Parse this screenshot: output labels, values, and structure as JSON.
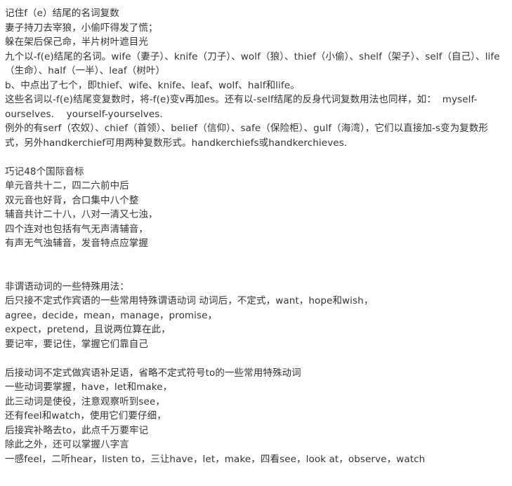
{
  "document": {
    "sections": [
      {
        "id": "f-e-plural-nouns",
        "lines": [
          "记住f（e）结尾的名词复数",
          "妻子持刀去宰狼，小偷吓得发了慌；",
          "躲在架后保己命，半片树叶遮目光",
          "九个以-f(e)结尾的名词。wife（妻子）、knife（刀子）、wolf（狼）、thief（小偷）、shelf（架子）、self（自己）、life（生命）、half（一半）、leaf（树叶）",
          "b、中点出了七个，即thief、wife、knife、leaf、wolf、half和life。",
          "这些名词以-f(e)结尾变复数时，将-f(e)变v再加es。还有以-self结尾的反身代词复数用法也同样，如：  myself-ourselves.    yourself-yourselves.",
          "例外的有serf（农奴）、chief（首领）、belief（信仰）、safe（保险柜）、gulf（海湾），它们以直接加-s变为复数形式，另外handkerchief可用两种复数形式。handkerchiefs或handkerchieves."
        ]
      },
      {
        "id": "phonetic-symbols",
        "lines": [
          "巧记48个国际音标",
          "单元音共十二，四二六前中后",
          "双元音也好背，合口集中八个整",
          "辅音共计二十八，八对一清又七浊，",
          "四个连对也包括有气无声清辅音，",
          "有声无气浊辅音，发音特点应掌握"
        ]
      },
      {
        "id": "non-finite-verbs",
        "lines": [
          "非谓语动词的一些特殊用法：",
          "后只接不定式作宾语的一些常用特殊谓语动词 动词后，不定式，want，hope和wish，",
          "agree，decide，mean，manage，promise，",
          "expect，pretend，且说两位算在此，",
          "要记牢，要记住，掌握它们靠自己"
        ]
      },
      {
        "id": "bare-infinitive-verbs",
        "lines": [
          "后接动词不定式做宾语补足语，省略不定式符号to的一些常用特殊动词",
          "一些动词要掌握，have，let和make，",
          "此三动词是使役，注意观察听到see，",
          "还有feel和watch，使用它们要仔细，",
          "后接宾补略去to，此点千万要牢记",
          "除此之外，还可以掌握八字言",
          "一感feel，二听hear，listen to，三让have，let，make，四看see，look at，observe，watch"
        ]
      }
    ]
  }
}
